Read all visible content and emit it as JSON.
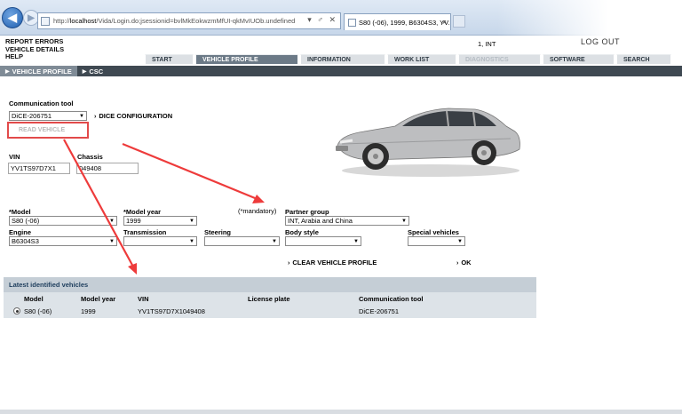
{
  "browser": {
    "url_prefix": "http://",
    "url_host": "localhost",
    "url_rest": "/Vida/Login.do;jsessionid=bvlMkEokwzmMfUI-qkMvIUOb.undefined",
    "addr_controls": "▾ ♂ ✕",
    "tab_title": "S80 (-06), 1999, B6304S3, YV...",
    "tab_close": "×"
  },
  "header": {
    "links": [
      "REPORT ERRORS",
      "VEHICLE DETAILS",
      "HELP"
    ],
    "user": "1, INT",
    "logout": "LOG OUT"
  },
  "tabs": [
    {
      "label": "START",
      "state": "normal"
    },
    {
      "label": "VEHICLE PROFILE",
      "state": "active"
    },
    {
      "label": "INFORMATION",
      "state": "normal"
    },
    {
      "label": "WORK LIST",
      "state": "normal"
    },
    {
      "label": "DIAGNOSTICS",
      "state": "disabled"
    },
    {
      "label": "SOFTWARE",
      "state": "normal"
    },
    {
      "label": "SEARCH",
      "state": "normal"
    }
  ],
  "subnav": {
    "active": "VEHICLE PROFILE",
    "other": "CSC"
  },
  "form": {
    "comm_tool_label": "Communication tool",
    "comm_tool_value": "DiCE-206751",
    "dice_config": "DICE CONFIGURATION",
    "read_vehicle": "READ VEHICLE",
    "vin_label": "VIN",
    "vin_value": "YV1TS97D7X1",
    "chassis_label": "Chassis",
    "chassis_value": "049408",
    "mandatory_note": "(*mandatory)",
    "model_label": "*Model",
    "model_value": "S80 (-06)",
    "model_year_label": "*Model year",
    "model_year_value": "1999",
    "partner_group_label": "Partner group",
    "partner_group_value": "INT, Arabia and China",
    "engine_label": "Engine",
    "engine_value": "B6304S3",
    "transmission_label": "Transmission",
    "transmission_value": "",
    "steering_label": "Steering",
    "steering_value": "",
    "body_style_label": "Body style",
    "body_style_value": "",
    "special_vehicles_label": "Special vehicles",
    "special_vehicles_value": "",
    "clear_profile": "CLEAR VEHICLE PROFILE",
    "ok": "OK"
  },
  "latest": {
    "title": "Latest identified vehicles",
    "columns": [
      "Model",
      "Model year",
      "VIN",
      "License plate",
      "Communication tool"
    ],
    "rows": [
      {
        "model": "S80 (-06)",
        "model_year": "1999",
        "vin": "YV1TS97D7X1049408",
        "license_plate": "",
        "comm_tool": "DiCE-206751"
      }
    ]
  },
  "colors": {
    "active_tab": "#6c7a87",
    "subnav": "#3f4952",
    "highlight_box": "#e24a4a",
    "annotation_arrow": "#ee3b3b"
  }
}
